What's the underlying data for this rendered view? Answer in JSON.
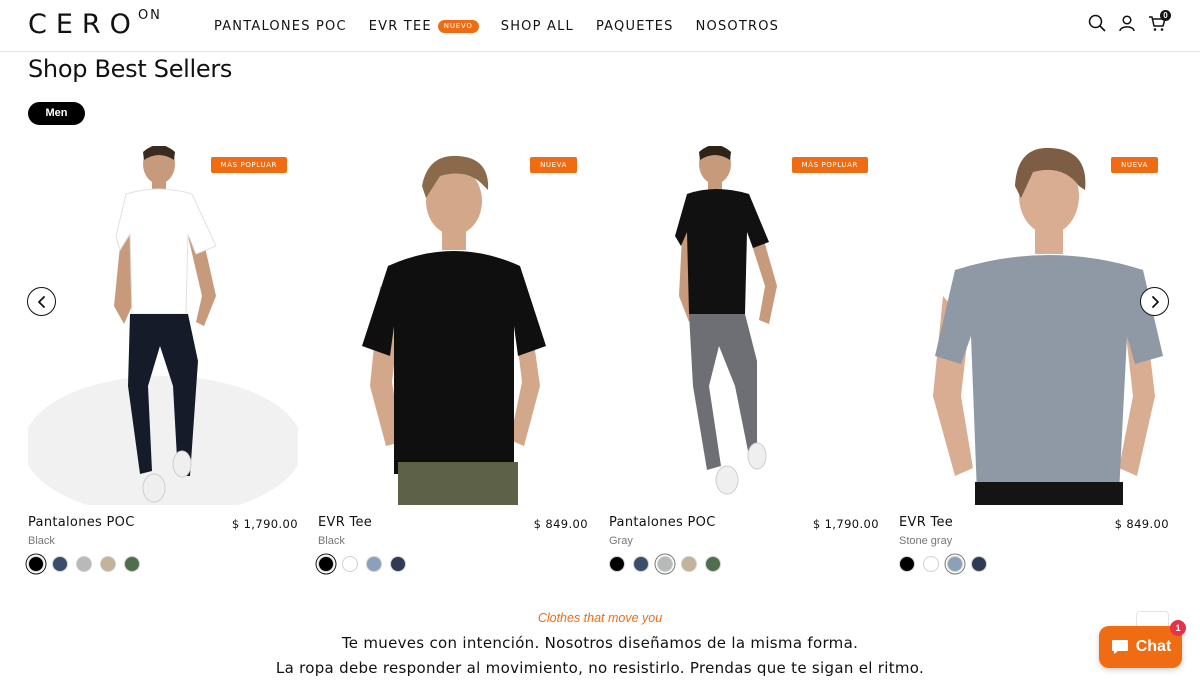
{
  "brand": {
    "logo_main": "CERO",
    "logo_sup": "ON"
  },
  "nav": {
    "items": [
      {
        "label": "PANTALONES POC"
      },
      {
        "label": "EVR TEE",
        "badge": "NUEVO"
      },
      {
        "label": "SHOP ALL"
      },
      {
        "label": "PAQUETES"
      },
      {
        "label": "NOSOTROS"
      }
    ],
    "cart_count": "0"
  },
  "section": {
    "title": "Shop Best Sellers",
    "filter_label": "Men"
  },
  "products": [
    {
      "name": "Pantalones POC",
      "price": "$ 1,790.00",
      "color": "Black",
      "badge": "MÁS POPLUAR",
      "swatches": [
        "#000000",
        "#3a4e6b",
        "#b8bab9",
        "#c2b39a",
        "#4e6e4d"
      ],
      "selected": 0
    },
    {
      "name": "EVR Tee",
      "price": "$ 849.00",
      "color": "Black",
      "badge": "NUEVA",
      "swatches": [
        "#000000",
        "#ffffff",
        "#8aa1b9",
        "#2f3a55"
      ],
      "selected": 0
    },
    {
      "name": "Pantalones POC",
      "price": "$ 1,790.00",
      "color": "Gray",
      "badge": "MÁS POPLUAR",
      "swatches": [
        "#000000",
        "#3a4e6b",
        "#b8bab9",
        "#c2b39a",
        "#4e6e4d"
      ],
      "selected": 2
    },
    {
      "name": "EVR Tee",
      "price": "$ 849.00",
      "color": "Stone gray",
      "badge": "NUEVA",
      "swatches": [
        "#000000",
        "#ffffff",
        "#8aa1b9",
        "#2f3a55"
      ],
      "selected": 2
    }
  ],
  "footer_text": {
    "tagline": "Clothes that move you",
    "line1": "Te mueves con intención. Nosotros diseñamos de la misma forma.",
    "line2": "La ropa debe responder al movimiento, no resistirlo. Prendas que te sigan el ritmo."
  },
  "chat": {
    "label": "Chat",
    "badge_count": "1"
  },
  "colors": {
    "accent": "#ef6c13",
    "text": "#111111",
    "muted": "#777777"
  }
}
